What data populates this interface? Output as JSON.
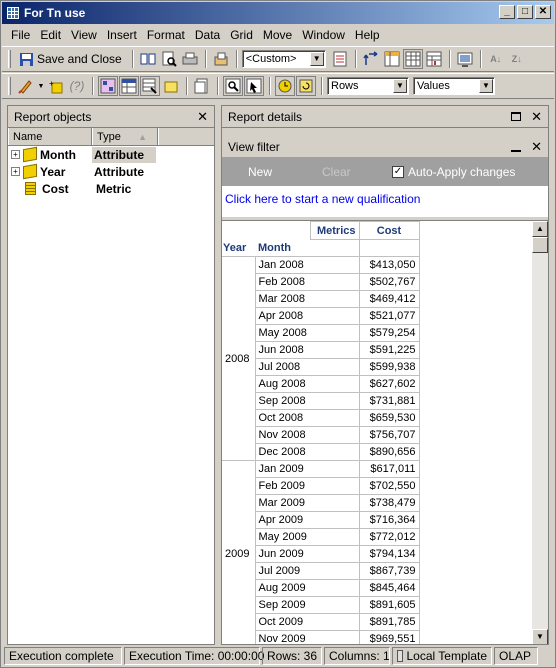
{
  "window": {
    "title": "For Tn use"
  },
  "menu": [
    "File",
    "Edit",
    "View",
    "Insert",
    "Format",
    "Data",
    "Grid",
    "Move",
    "Window",
    "Help"
  ],
  "toolbar": {
    "save_close": "Save and Close",
    "template": "<Custom>",
    "rows_select": "Rows",
    "values_select": "Values"
  },
  "report_objects": {
    "title": "Report objects",
    "columns": [
      "Name",
      "Type"
    ],
    "items": [
      {
        "name": "Month",
        "type": "Attribute"
      },
      {
        "name": "Year",
        "type": "Attribute"
      },
      {
        "name": "Cost",
        "type": "Metric"
      }
    ]
  },
  "report_details": {
    "title": "Report details"
  },
  "view_filter": {
    "title": "View filter",
    "new_label": "New",
    "clear_label": "Clear",
    "auto_apply_label": "Auto-Apply changes",
    "auto_apply_checked": true,
    "link": "Click here to start a new qualification"
  },
  "grid": {
    "metrics_header": "Metrics",
    "cost_header": "Cost",
    "year_header": "Year",
    "month_header": "Month",
    "groups": [
      {
        "year": "2008",
        "rows": [
          [
            "Jan 2008",
            "$413,050"
          ],
          [
            "Feb 2008",
            "$502,767"
          ],
          [
            "Mar 2008",
            "$469,412"
          ],
          [
            "Apr 2008",
            "$521,077"
          ],
          [
            "May 2008",
            "$579,254"
          ],
          [
            "Jun 2008",
            "$591,225"
          ],
          [
            "Jul 2008",
            "$599,938"
          ],
          [
            "Aug 2008",
            "$627,602"
          ],
          [
            "Sep 2008",
            "$731,881"
          ],
          [
            "Oct 2008",
            "$659,530"
          ],
          [
            "Nov 2008",
            "$756,707"
          ],
          [
            "Dec 2008",
            "$890,656"
          ]
        ]
      },
      {
        "year": "2009",
        "rows": [
          [
            "Jan 2009",
            "$617,011"
          ],
          [
            "Feb 2009",
            "$702,550"
          ],
          [
            "Mar 2009",
            "$738,479"
          ],
          [
            "Apr 2009",
            "$716,364"
          ],
          [
            "May 2009",
            "$772,012"
          ],
          [
            "Jun 2009",
            "$794,134"
          ],
          [
            "Jul 2009",
            "$867,739"
          ],
          [
            "Aug 2009",
            "$845,464"
          ],
          [
            "Sep 2009",
            "$891,605"
          ],
          [
            "Oct 2009",
            "$891,785"
          ],
          [
            "Nov 2009",
            "$969,551"
          ]
        ]
      }
    ]
  },
  "status": {
    "execution": "Execution complete",
    "time": "Execution Time: 00:00:00",
    "rows": "Rows: 36",
    "columns": "Columns: 1",
    "template": "Local Template",
    "mode": "OLAP"
  }
}
